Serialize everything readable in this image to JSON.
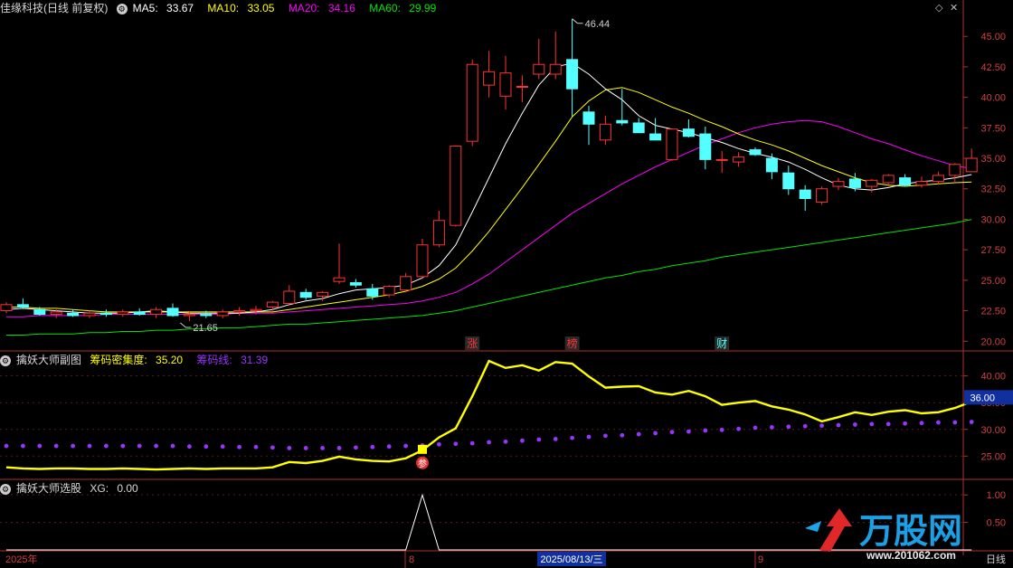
{
  "main_header": {
    "stock": "佳缘科技(日线 前复权)",
    "ma5_label": "MA5:",
    "ma5_value": "33.67",
    "ma10_label": "MA10:",
    "ma10_value": "33.05",
    "ma20_label": "MA20:",
    "ma20_value": "34.16",
    "ma60_label": "MA60:",
    "ma60_value": "29.99"
  },
  "sub1_header": {
    "name": "擒妖大师副图",
    "density_label": "筹码密集度:",
    "density_value": "35.20",
    "chip_label": "筹码线:",
    "chip_value": "31.39"
  },
  "sub2_header": {
    "name": "擒妖大师选股",
    "xg_label": "XG:",
    "xg_value": "0.00"
  },
  "colors": {
    "up": "#ff3232",
    "down": "#54ffff",
    "ma5": "#ffffff",
    "ma10": "#ffff00",
    "ma20": "#ff00ff",
    "ma60": "#00e600",
    "density": "#ffff00",
    "chip": "#9933ff",
    "axis": "#b03030"
  },
  "bottom_axis": {
    "start_label": "2025年",
    "aug_label": "8",
    "cursor_label": "2025/08/13/三",
    "sep_label": "9",
    "period_label": "日线"
  },
  "watermark": {
    "brand": "万股网",
    "url": "www.201062.com"
  },
  "chart_data": [
    {
      "type": "candlestick",
      "name": "price",
      "ylim": [
        19.5,
        46.5
      ],
      "y_ticks": [
        "45.00",
        "42.50",
        "40.00",
        "37.50",
        "35.00",
        "32.50",
        "30.00",
        "27.50",
        "25.00",
        "22.50",
        "20.00"
      ],
      "y_tick_values": [
        45,
        42.5,
        40,
        37.5,
        35,
        32.5,
        30,
        27.5,
        25,
        22.5,
        20
      ],
      "high_annotation": "46.44",
      "low_annotation": "21.65",
      "event_markers": [
        {
          "label": "涨",
          "index": 28,
          "color": "#ff3232"
        },
        {
          "label": "榜",
          "index": 34,
          "color": "#ff3232"
        },
        {
          "label": "财",
          "index": 43,
          "color": "#54ffff"
        }
      ],
      "candles": [
        [
          22.5,
          23.2,
          22.3,
          23.0
        ],
        [
          23.0,
          23.5,
          22.7,
          22.8
        ],
        [
          22.6,
          22.8,
          22.1,
          22.2
        ],
        [
          22.2,
          22.6,
          21.9,
          22.4
        ],
        [
          22.3,
          22.6,
          22.0,
          22.1
        ],
        [
          22.1,
          22.5,
          21.9,
          22.3
        ],
        [
          22.3,
          22.6,
          22.0,
          22.2
        ],
        [
          22.2,
          22.6,
          22.0,
          22.4
        ],
        [
          22.4,
          22.7,
          22.1,
          22.2
        ],
        [
          22.2,
          22.8,
          21.9,
          22.6
        ],
        [
          22.7,
          23.1,
          22.0,
          22.1
        ],
        [
          22.1,
          22.4,
          21.65,
          22.2
        ],
        [
          22.2,
          22.5,
          21.9,
          22.1
        ],
        [
          22.1,
          22.6,
          21.9,
          22.4
        ],
        [
          22.4,
          22.8,
          22.1,
          22.5
        ],
        [
          22.5,
          22.9,
          22.2,
          22.6
        ],
        [
          22.8,
          23.3,
          22.5,
          23.2
        ],
        [
          23.1,
          24.6,
          22.9,
          24.1
        ],
        [
          24.0,
          24.3,
          23.4,
          23.6
        ],
        [
          23.7,
          24.1,
          23.3,
          24.0
        ],
        [
          24.9,
          28.0,
          24.7,
          25.2
        ],
        [
          24.8,
          25.1,
          24.4,
          24.6
        ],
        [
          24.3,
          24.7,
          23.4,
          23.7
        ],
        [
          23.8,
          24.6,
          23.6,
          24.5
        ],
        [
          24.2,
          25.6,
          24.0,
          25.3
        ],
        [
          25.3,
          28.4,
          25.1,
          27.9
        ],
        [
          27.9,
          30.7,
          27.7,
          29.9
        ],
        [
          29.5,
          35.2,
          29.4,
          36.0
        ],
        [
          36.4,
          43.1,
          36.0,
          42.7
        ],
        [
          41.0,
          43.8,
          40.0,
          42.1
        ],
        [
          40.1,
          43.4,
          39.0,
          42.0
        ],
        [
          40.9,
          41.8,
          39.6,
          40.9
        ],
        [
          41.9,
          44.8,
          41.5,
          42.7
        ],
        [
          41.9,
          45.4,
          41.5,
          42.7
        ],
        [
          43.1,
          46.44,
          38.4,
          40.7
        ],
        [
          38.8,
          39.3,
          36.1,
          37.8
        ],
        [
          36.5,
          38.5,
          36.1,
          37.8
        ],
        [
          38.1,
          40.7,
          37.7,
          37.9
        ],
        [
          37.9,
          38.3,
          37.1,
          37.1
        ],
        [
          37.0,
          38.3,
          36.6,
          36.5
        ],
        [
          34.9,
          37.4,
          34.8,
          37.4
        ],
        [
          37.4,
          38.2,
          36.7,
          36.8
        ],
        [
          37.0,
          37.6,
          34.1,
          34.9
        ],
        [
          34.9,
          35.6,
          33.8,
          34.9
        ],
        [
          34.7,
          35.5,
          34.3,
          35.1
        ],
        [
          35.7,
          35.9,
          35.2,
          35.3
        ],
        [
          35.0,
          35.4,
          33.3,
          33.9
        ],
        [
          33.8,
          34.4,
          32.0,
          32.5
        ],
        [
          32.4,
          32.8,
          30.7,
          31.7
        ],
        [
          31.4,
          32.7,
          31.2,
          32.5
        ],
        [
          32.7,
          33.4,
          32.4,
          33.1
        ],
        [
          33.3,
          33.8,
          32.3,
          32.6
        ],
        [
          32.7,
          33.3,
          32.2,
          33.2
        ],
        [
          33.0,
          33.7,
          32.7,
          33.6
        ],
        [
          33.4,
          33.7,
          32.7,
          32.8
        ],
        [
          32.8,
          33.5,
          32.6,
          33.1
        ],
        [
          33.1,
          33.9,
          32.9,
          33.6
        ],
        [
          33.6,
          34.6,
          33.0,
          34.5
        ],
        [
          33.9,
          35.8,
          33.9,
          35.0
        ]
      ],
      "ma5": [
        22.6,
        22.7,
        22.6,
        22.5,
        22.4,
        22.3,
        22.3,
        22.3,
        22.4,
        22.5,
        22.4,
        22.3,
        22.3,
        22.3,
        22.3,
        22.4,
        22.6,
        23.0,
        23.3,
        23.5,
        23.9,
        24.2,
        24.3,
        24.4,
        24.6,
        25.2,
        26.2,
        27.9,
        30.6,
        33.4,
        36.2,
        38.7,
        41.0,
        42.5,
        42.8,
        41.9,
        40.7,
        39.8,
        38.5,
        37.7,
        37.4,
        37.1,
        36.7,
        36.3,
        35.8,
        35.4,
        35.1,
        34.7,
        34.1,
        33.4,
        32.8,
        32.5,
        32.4,
        32.6,
        32.9,
        33.1,
        33.2,
        33.4,
        33.67
      ],
      "ma10": [
        22.8,
        22.8,
        22.7,
        22.7,
        22.6,
        22.5,
        22.4,
        22.4,
        22.4,
        22.4,
        22.4,
        22.4,
        22.4,
        22.4,
        22.4,
        22.4,
        22.4,
        22.6,
        22.8,
        23.0,
        23.2,
        23.4,
        23.6,
        23.8,
        24.1,
        24.5,
        25.1,
        26.0,
        27.4,
        29.0,
        30.8,
        32.6,
        34.5,
        36.4,
        38.4,
        39.7,
        40.6,
        40.8,
        40.4,
        39.8,
        39.2,
        38.7,
        38.1,
        37.6,
        37.0,
        36.5,
        36.1,
        35.6,
        35.0,
        34.4,
        33.9,
        33.4,
        33.0,
        32.8,
        32.7,
        32.8,
        32.9,
        33.0,
        33.05
      ],
      "ma20": [
        22.0,
        22.0,
        22.1,
        22.1,
        22.1,
        22.1,
        22.2,
        22.2,
        22.2,
        22.2,
        22.2,
        22.2,
        22.2,
        22.2,
        22.3,
        22.3,
        22.3,
        22.4,
        22.5,
        22.6,
        22.7,
        22.8,
        22.9,
        23.0,
        23.1,
        23.3,
        23.6,
        24.0,
        24.7,
        25.5,
        26.5,
        27.5,
        28.5,
        29.5,
        30.5,
        31.3,
        32.1,
        32.9,
        33.6,
        34.3,
        34.9,
        35.5,
        36.1,
        36.6,
        37.1,
        37.5,
        37.8,
        38.0,
        38.1,
        38.0,
        37.6,
        37.1,
        36.6,
        36.2,
        35.7,
        35.2,
        34.8,
        34.4,
        34.16
      ],
      "ma60": [
        20.5,
        20.5,
        20.6,
        20.6,
        20.6,
        20.7,
        20.7,
        20.8,
        20.8,
        20.9,
        20.9,
        21.0,
        21.0,
        21.1,
        21.1,
        21.2,
        21.3,
        21.4,
        21.4,
        21.5,
        21.6,
        21.7,
        21.8,
        21.9,
        22.0,
        22.1,
        22.3,
        22.5,
        22.8,
        23.1,
        23.4,
        23.7,
        24.0,
        24.3,
        24.6,
        24.9,
        25.2,
        25.4,
        25.7,
        25.9,
        26.2,
        26.4,
        26.6,
        26.9,
        27.1,
        27.3,
        27.5,
        27.7,
        27.9,
        28.1,
        28.3,
        28.5,
        28.7,
        28.9,
        29.1,
        29.3,
        29.5,
        29.7,
        29.99
      ]
    },
    {
      "type": "line",
      "name": "擒妖大师副图",
      "ylim": [
        21.5,
        44
      ],
      "y_ticks": [
        "40.00",
        "35.00",
        "30.00",
        "25.00"
      ],
      "y_tick_values": [
        40,
        35,
        30,
        25
      ],
      "current_value_label": "36.00",
      "buy_marker": {
        "label": "参",
        "index": 25
      },
      "series": [
        {
          "name": "筹码密集度",
          "values": [
            22.9,
            22.7,
            22.6,
            22.7,
            22.7,
            22.6,
            22.6,
            22.7,
            22.6,
            22.5,
            22.6,
            22.7,
            22.6,
            22.7,
            22.7,
            22.7,
            22.9,
            23.9,
            23.7,
            24.1,
            24.9,
            24.4,
            24.1,
            24.0,
            24.6,
            26.1,
            28.5,
            30.2,
            36.2,
            42.8,
            41.5,
            42.0,
            41.0,
            42.6,
            42.3,
            39.9,
            37.8,
            38.0,
            38.1,
            36.9,
            36.5,
            37.2,
            36.2,
            34.6,
            35.0,
            35.3,
            34.3,
            33.7,
            32.8,
            31.5,
            32.3,
            33.2,
            32.7,
            33.3,
            33.6,
            33.0,
            33.2,
            34.0,
            35.2
          ]
        },
        {
          "name": "筹码线",
          "values": [
            26.9,
            26.9,
            26.9,
            26.9,
            26.9,
            26.9,
            26.9,
            26.9,
            26.9,
            26.9,
            26.9,
            26.8,
            26.8,
            26.8,
            26.7,
            26.7,
            26.6,
            26.5,
            26.5,
            26.5,
            26.5,
            26.6,
            26.7,
            26.8,
            26.9,
            27.0,
            27.2,
            27.3,
            27.4,
            27.6,
            27.7,
            27.9,
            28.1,
            28.2,
            28.4,
            28.6,
            28.8,
            28.9,
            29.1,
            29.3,
            29.5,
            29.6,
            29.8,
            29.9,
            30.1,
            30.3,
            30.4,
            30.5,
            30.6,
            30.7,
            30.8,
            30.9,
            31.0,
            31.0,
            31.1,
            31.2,
            31.3,
            31.3,
            31.39
          ]
        }
      ]
    },
    {
      "type": "line",
      "name": "擒妖大师选股",
      "ylim": [
        0,
        1.2
      ],
      "y_ticks": [
        "1.00",
        "0.50"
      ],
      "y_tick_values": [
        1,
        0.5
      ],
      "series": [
        {
          "name": "XG",
          "values": [
            0,
            0,
            0,
            0,
            0,
            0,
            0,
            0,
            0,
            0,
            0,
            0,
            0,
            0,
            0,
            0,
            0,
            0,
            0,
            0,
            0,
            0,
            0,
            0,
            0,
            1,
            0,
            0,
            0,
            0,
            0,
            0,
            0,
            0,
            0,
            0,
            0,
            0,
            0,
            0,
            0,
            0,
            0,
            0,
            0,
            0,
            0,
            0,
            0,
            0,
            0,
            0,
            0,
            0,
            0,
            0,
            0,
            0,
            0
          ]
        }
      ]
    }
  ]
}
